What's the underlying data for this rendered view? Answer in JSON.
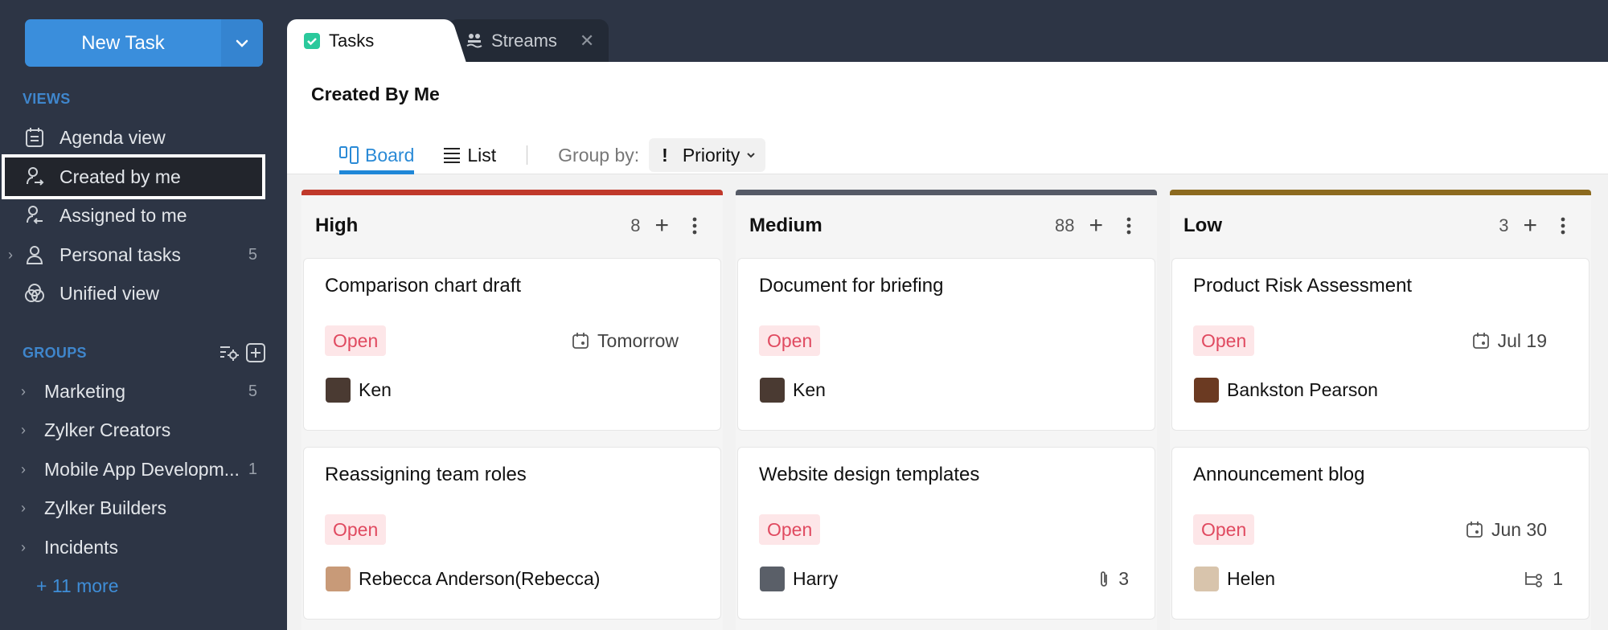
{
  "sidebar": {
    "new_task_label": "New Task",
    "views_label": "VIEWS",
    "views": [
      {
        "label": "Agenda view",
        "icon": "agenda-icon"
      },
      {
        "label": "Created by me",
        "icon": "created-by-me-icon",
        "active": true
      },
      {
        "label": "Assigned to me",
        "icon": "assigned-to-me-icon"
      },
      {
        "label": "Personal tasks",
        "icon": "person-icon",
        "count": "5"
      },
      {
        "label": "Unified view",
        "icon": "unified-view-icon"
      }
    ],
    "groups_label": "GROUPS",
    "groups": [
      {
        "label": "Marketing",
        "count": "5"
      },
      {
        "label": "Zylker Creators",
        "count": ""
      },
      {
        "label": "Mobile App Developm...",
        "count": "1"
      },
      {
        "label": "Zylker Builders",
        "count": ""
      },
      {
        "label": "Incidents",
        "count": ""
      }
    ],
    "more_link": "+ 11 more"
  },
  "tabs": [
    {
      "label": "Tasks",
      "icon": "tasks-check-icon",
      "active": true
    },
    {
      "label": "Streams",
      "icon": "streams-icon",
      "active": false
    }
  ],
  "main": {
    "title": "Created By Me",
    "view_tabs": [
      {
        "label": "Board",
        "active": true
      },
      {
        "label": "List",
        "active": false
      }
    ],
    "group_by_label": "Group by:",
    "group_by_value": "Priority"
  },
  "colors": {
    "high": "#c0392b",
    "medium": "#555a66",
    "low": "#8c6a1f",
    "accent": "#2a8ad6",
    "status_open": "#e04a60"
  },
  "columns": [
    {
      "title": "High",
      "count": "8",
      "cards": [
        {
          "title": "Comparison chart draft",
          "status": "Open",
          "due": "Tomorrow",
          "assignee": "Ken",
          "meta_icon": "",
          "meta_value": ""
        },
        {
          "title": "Reassigning team roles",
          "status": "Open",
          "due": "",
          "assignee": "Rebecca Anderson(Rebecca)",
          "meta_icon": "",
          "meta_value": ""
        }
      ]
    },
    {
      "title": "Medium",
      "count": "88",
      "cards": [
        {
          "title": "Document for briefing",
          "status": "Open",
          "due": "",
          "assignee": "Ken",
          "meta_icon": "",
          "meta_value": ""
        },
        {
          "title": "Website design templates",
          "status": "Open",
          "due": "",
          "assignee": "Harry",
          "meta_icon": "attachment-icon",
          "meta_value": "3"
        }
      ]
    },
    {
      "title": "Low",
      "count": "3",
      "cards": [
        {
          "title": "Product Risk Assessment",
          "status": "Open",
          "due": "Jul 19",
          "assignee": "Bankston Pearson",
          "meta_icon": "",
          "meta_value": ""
        },
        {
          "title": "Announcement blog",
          "status": "Open",
          "due": "Jun 30",
          "assignee": "Helen",
          "meta_icon": "subtask-icon",
          "meta_value": "1"
        }
      ]
    }
  ]
}
